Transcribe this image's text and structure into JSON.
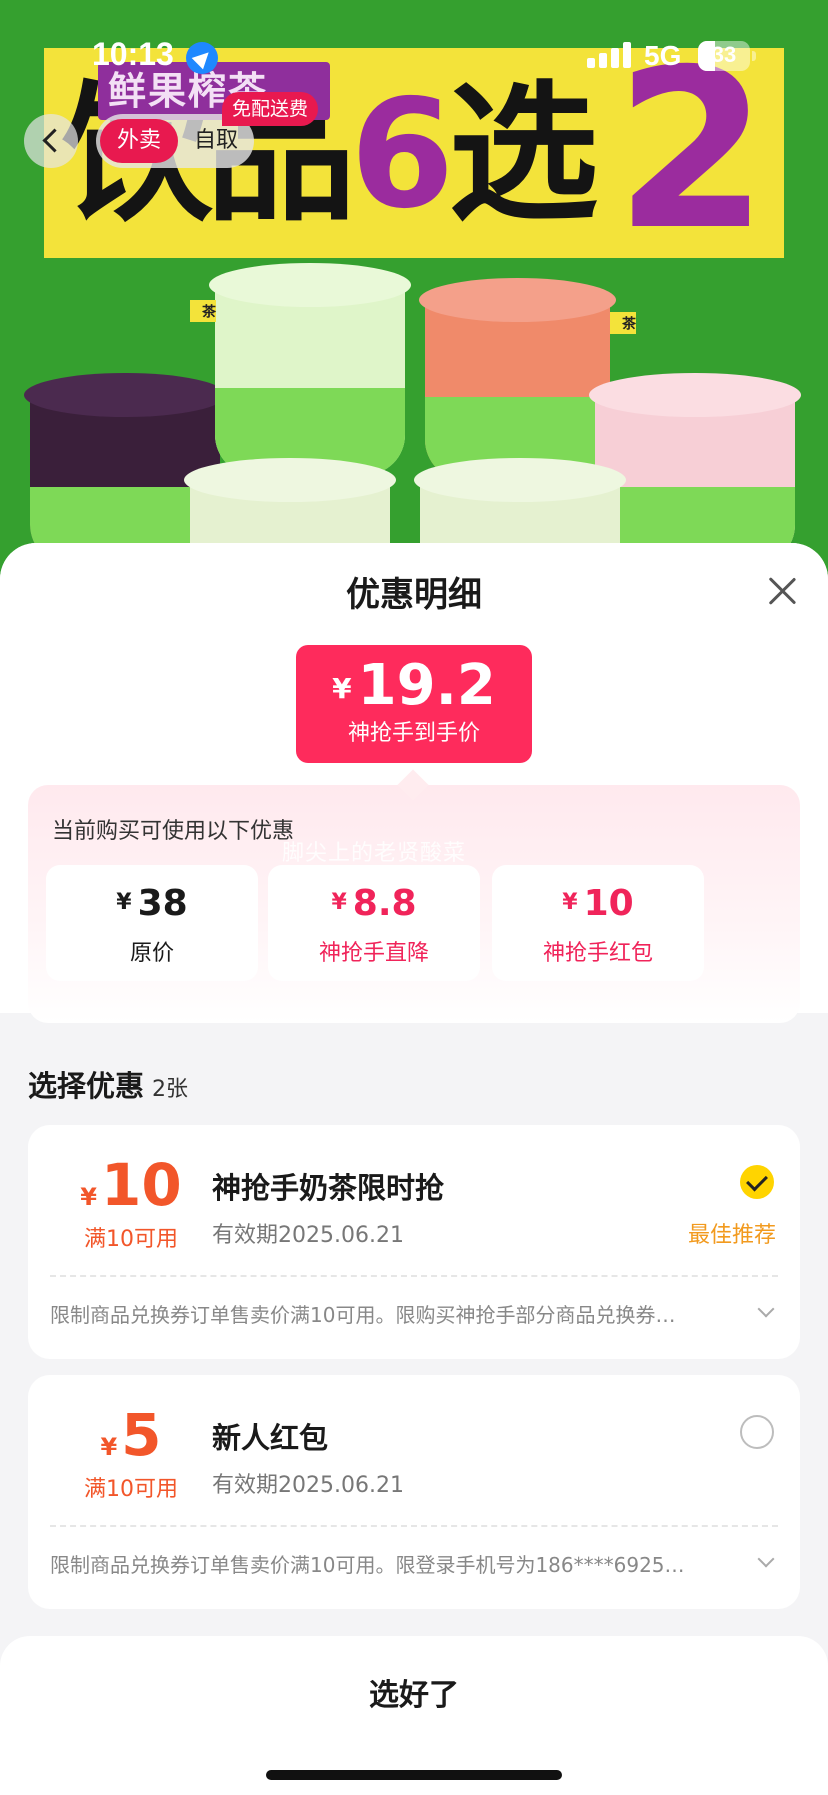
{
  "status_bar": {
    "time": "10:13",
    "network": "5G",
    "battery": "33"
  },
  "nav": {
    "tab_delivery": "外卖",
    "tab_pickup": "自取",
    "free_delivery_tag": "免配送费"
  },
  "hero": {
    "banner_text": "鲜果榨茶",
    "title_part1": "饮品",
    "title_num": "6",
    "title_part2": "选",
    "title_num2": "2"
  },
  "sheet": {
    "title": "优惠明细",
    "final_price": {
      "currency": "¥",
      "amount": "19.2",
      "caption": "神抢手到手价"
    },
    "breakdown": {
      "hint": "当前购买可使用以下优惠",
      "watermark": "脚尖上的老贤酸菜",
      "minus_symbol": "-",
      "items": [
        {
          "currency": "¥",
          "value": "38",
          "label": "原价"
        },
        {
          "currency": "¥",
          "value": "8.8",
          "label": "神抢手直降"
        },
        {
          "currency": "¥",
          "value": "10",
          "label": "神抢手红包"
        }
      ]
    },
    "select_title": "选择优惠",
    "select_count": "2张",
    "coupons": [
      {
        "currency": "¥",
        "amount": "10",
        "condition": "满10可用",
        "name": "神抢手奶茶限时抢",
        "validity": "有效期2025.06.21",
        "tag": "最佳推荐",
        "selected": true,
        "desc": "限制商品兑换券订单售卖价满10可用。限购买神抢手部分商品兑换券…"
      },
      {
        "currency": "¥",
        "amount": "5",
        "condition": "满10可用",
        "name": "新人红包",
        "validity": "有效期2025.06.21",
        "tag": "",
        "selected": false,
        "desc": "限制商品兑换券订单售卖价满10可用。限登录手机号为186****6925…"
      }
    ],
    "confirm_label": "选好了"
  },
  "colors": {
    "accent_red": "#fe2b5c",
    "coupon_orange": "#f2562a",
    "tag_orange": "#f29a1e",
    "check_yellow": "#ffd400"
  }
}
